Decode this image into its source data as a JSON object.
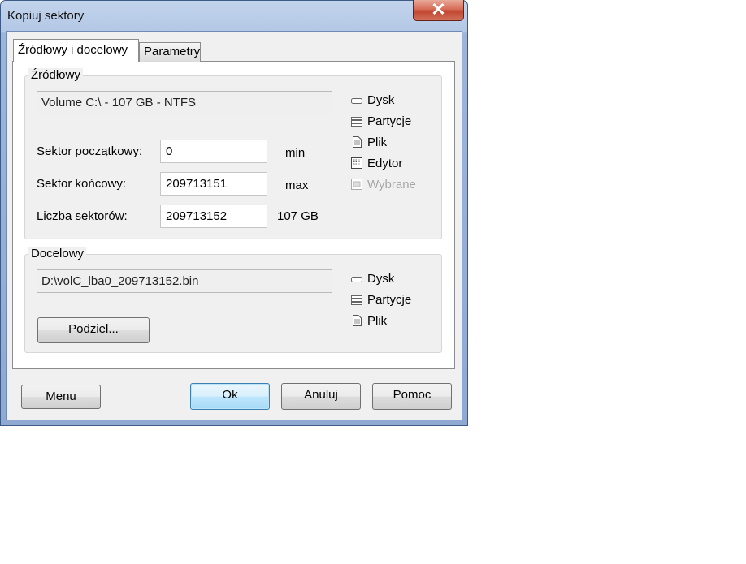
{
  "window": {
    "title": "Kopiuj sektory",
    "close_glyph": "✕"
  },
  "tabs": [
    {
      "label": "Źródłowy i docelowy",
      "active": true
    },
    {
      "label": "Parametry",
      "active": false
    }
  ],
  "source": {
    "group_label": "Źródłowy",
    "path": "Volume C:\\ - 107 GB - NTFS",
    "start_sector": {
      "label": "Sektor początkowy:",
      "value": "0",
      "hint": "min"
    },
    "end_sector": {
      "label": "Sektor końcowy:",
      "value": "209713151",
      "hint": "max"
    },
    "sector_count": {
      "label": "Liczba sektorów:",
      "value": "209713152",
      "hint": "107 GB"
    },
    "options": [
      {
        "label": "Dysk",
        "icon": "disk-icon",
        "enabled": true
      },
      {
        "label": "Partycje",
        "icon": "partitions-icon",
        "enabled": true
      },
      {
        "label": "Plik",
        "icon": "file-icon",
        "enabled": true
      },
      {
        "label": "Edytor",
        "icon": "editor-icon",
        "enabled": true
      },
      {
        "label": "Wybrane",
        "icon": "selection-icon",
        "enabled": false
      }
    ]
  },
  "target": {
    "group_label": "Docelowy",
    "path": "D:\\volC_lba0_209713152.bin",
    "split_button": "Podziel...",
    "options": [
      {
        "label": "Dysk",
        "icon": "disk-icon",
        "enabled": true
      },
      {
        "label": "Partycje",
        "icon": "partitions-icon",
        "enabled": true
      },
      {
        "label": "Plik",
        "icon": "file-icon",
        "enabled": true
      }
    ]
  },
  "footer": {
    "menu": "Menu",
    "ok": "Ok",
    "cancel": "Anuluj",
    "help": "Pomoc"
  },
  "colors": {
    "title_bar": "#b3c8e6",
    "close_button": "#c24630",
    "default_button_border": "#3c7fb1"
  }
}
